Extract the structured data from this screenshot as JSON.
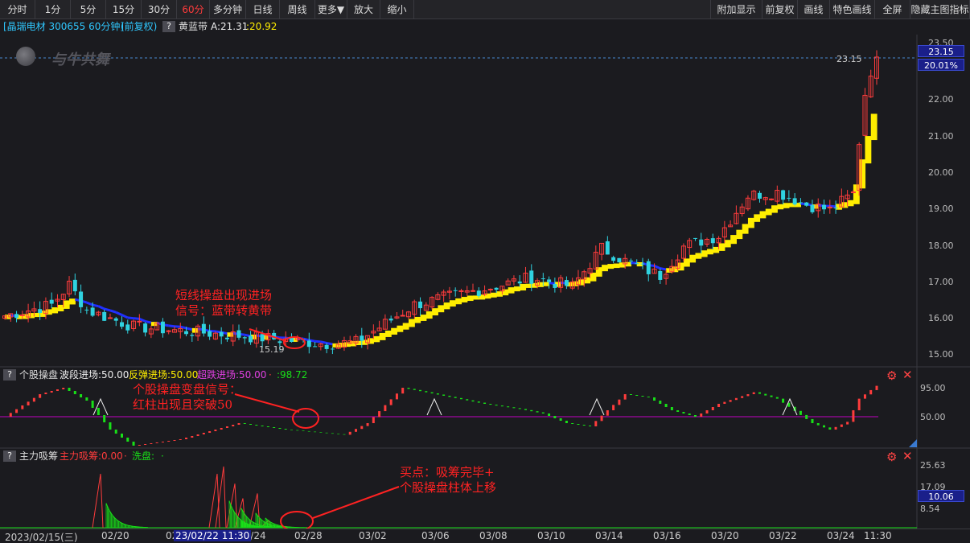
{
  "toolbar": {
    "left": [
      "分时",
      "1分",
      "5分",
      "15分",
      "30分",
      "60分",
      "多分钟",
      "日线",
      "周线",
      "更多▼",
      "放大",
      "缩小"
    ],
    "active": "60分",
    "right": [
      "附加显示",
      "前复权",
      "画线",
      "特色画线",
      "全屏",
      "隐藏主图指标"
    ]
  },
  "stock": {
    "title": "[晶瑞电材 300655 60分钟]",
    "adjust": "(前复权)",
    "help": "?",
    "indicator_name": "黄蓝带",
    "indicator_a": "A:21.31",
    "indicator_b": ":20.92"
  },
  "watermark": "与牛共舞",
  "price_axis": {
    "ticks": [
      "23.50",
      "22.00",
      "21.00",
      "20.00",
      "19.00",
      "18.00",
      "17.00",
      "16.00",
      "15.00"
    ],
    "current": "23.15",
    "change": "20.01%",
    "high_label": "23.15",
    "low_label": "15.19"
  },
  "panel1": {
    "help": "?",
    "name": "个股操盘",
    "f1": "波段进场:50.00",
    "f2": "反弹进场:50.00",
    "f3": "超跌进场:50.00",
    "f4": "·",
    "f5": ":98.72",
    "ticks": [
      "95.00",
      "50.00"
    ]
  },
  "panel2": {
    "help": "?",
    "name": "主力吸筹",
    "f1": "主力吸筹:0.00",
    "f2": "·",
    "f3": "洗盘:",
    "f4": "·",
    "ticks": [
      "25.63",
      "17.09",
      "8.54"
    ],
    "badge": "10.06"
  },
  "annotations": {
    "a1": "短线操盘出现进场\n信号：蓝带转黄带",
    "a2": "个股操盘变盘信号：\n红柱出现且突破50",
    "a3": "买点：吸筹完毕+\n个股操盘柱体上移"
  },
  "date_axis": {
    "labels": [
      "2023/02/15(三)",
      "02/20",
      "02",
      "02/24",
      "02/28",
      "03/02",
      "03/06",
      "03/08",
      "03/10",
      "03/14",
      "03/16",
      "03/20",
      "03/22",
      "03/24",
      "11:30"
    ],
    "cursor": "23/02/22 11:30"
  },
  "colors": {
    "up": "#ff3c3c",
    "down": "#2fd2e0",
    "yellow_band": "#ffee00",
    "blue_band": "#2030ff",
    "magenta": "#c000c0",
    "green": "#18e018",
    "annotation": "#ff2222"
  },
  "icons": [
    "gear-icon",
    "close-icon",
    "help-icon",
    "scroll-triangle-icon",
    "watermark-logo-icon"
  ]
}
